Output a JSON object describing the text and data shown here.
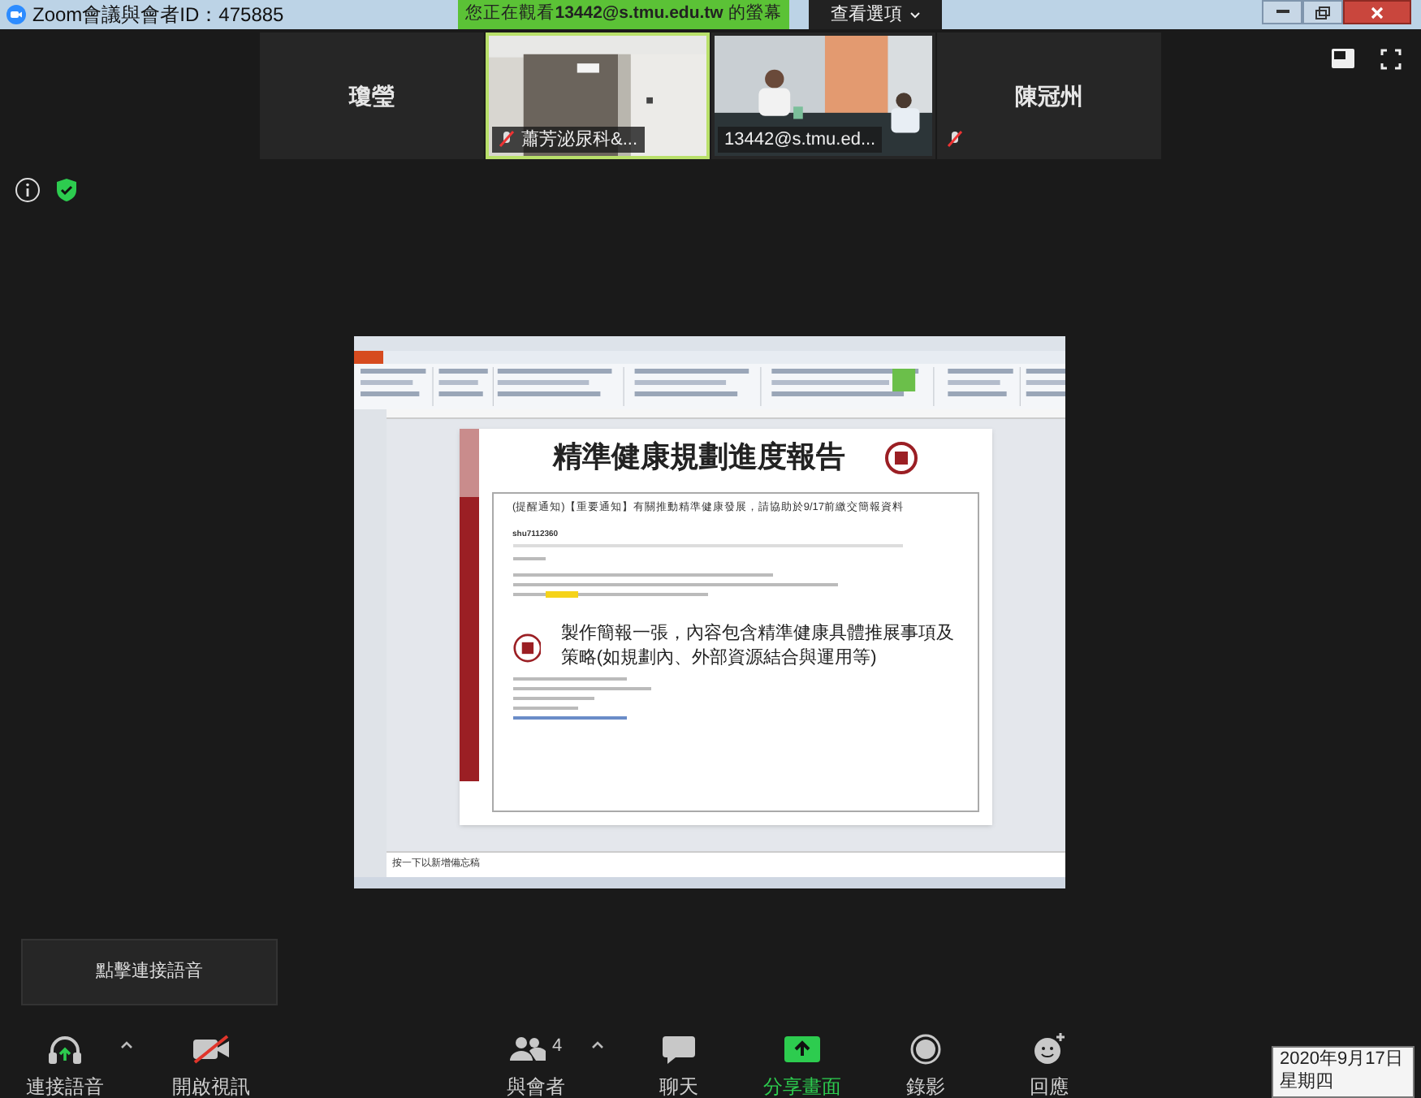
{
  "window": {
    "title": "Zoom會議與會者ID：475885"
  },
  "banner": {
    "prefix": "您正在觀看",
    "user": "13442@s.tmu.edu.tw",
    "suffix": "的螢幕"
  },
  "view_options": {
    "label": "查看選項"
  },
  "participants": [
    {
      "kind": "name",
      "name": "瓊瑩",
      "muted": false
    },
    {
      "kind": "video",
      "name": "蕭芳泌尿科&...",
      "muted": true,
      "selected": true
    },
    {
      "kind": "video",
      "name": "13442@s.tmu.ed...",
      "muted": false,
      "selected": false
    },
    {
      "kind": "name",
      "name": "陳冠州",
      "muted": true
    }
  ],
  "shared_screen": {
    "slide_title": "精準健康規劃進度報告",
    "email_subject": "(提醒通知)【重要通知】有關推動精準健康發展，請協助於9/17前繳交簡報資料",
    "email_sender": "shu7112360",
    "slide_body": "製作簡報一張，內容包含精準健康具體推展事項及策略(如規劃內、外部資源結合與運用等)",
    "notes": "按一下以新增備忘稿"
  },
  "tooltip": "點擊連接語音",
  "toolbar": [
    {
      "kind": "audio",
      "label": "連接語音",
      "has_menu": true,
      "active": false
    },
    {
      "kind": "video",
      "label": "開啟視訊",
      "has_menu": false,
      "active": false
    },
    {
      "kind": "participants",
      "label": "與會者",
      "count": "4",
      "has_menu": true,
      "active": false
    },
    {
      "kind": "chat",
      "label": "聊天",
      "has_menu": false,
      "active": false
    },
    {
      "kind": "share",
      "label": "分享畫面",
      "has_menu": false,
      "active": true
    },
    {
      "kind": "record",
      "label": "錄影",
      "has_menu": false,
      "active": false
    },
    {
      "kind": "reactions",
      "label": "回應",
      "has_menu": false,
      "active": false
    }
  ],
  "clock": {
    "date": "2020年9月17日",
    "weekday": "星期四"
  }
}
